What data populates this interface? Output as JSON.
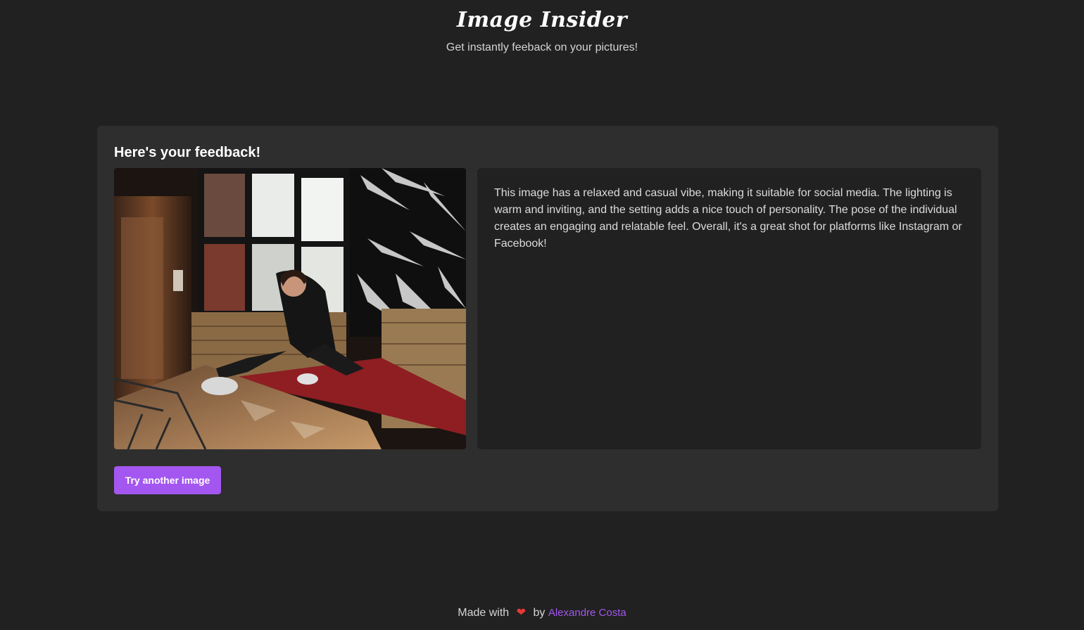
{
  "header": {
    "title": "Image Insider",
    "subtitle": "Get instantly feeback on your pictures!"
  },
  "result": {
    "heading": "Here's your feedback!",
    "feedback": "This image has a relaxed and casual vibe, making it suitable for social media. The lighting is warm and inviting, and the setting adds a nice touch of personality. The pose of the individual creates an engaging and relatable feel. Overall, it's a great shot for platforms like Instagram or Facebook!",
    "button_label": "Try another image"
  },
  "footer": {
    "made_with": "Made with",
    "heart_icon": "heart-icon",
    "by": "by",
    "author": "Alexandre Costa"
  },
  "colors": {
    "background": "#212121",
    "card": "#2e2e2e",
    "accent": "#a356f0",
    "heart": "#e53935"
  }
}
